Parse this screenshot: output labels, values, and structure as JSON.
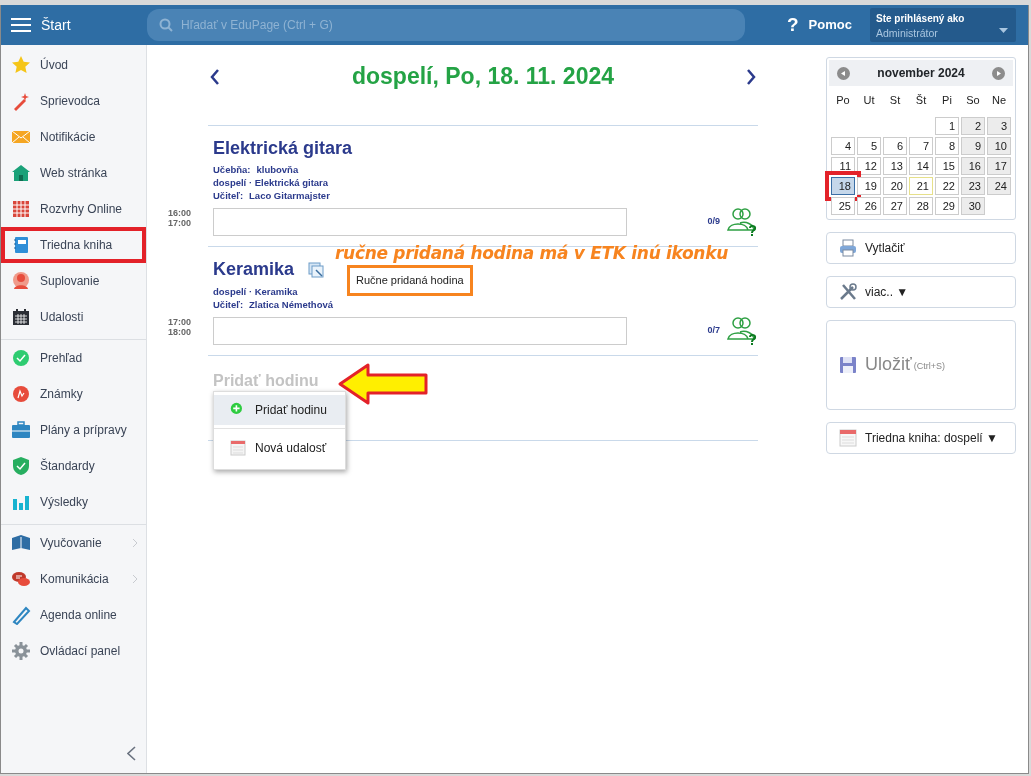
{
  "header": {
    "menu_label": "Štart",
    "search": {
      "placeholder": "Hľadať v EduPage (Ctrl + G)"
    },
    "help_icon": "?",
    "help": "Pomoc",
    "user": {
      "caption": "Ste prihlásený ako",
      "name": "Administrátor"
    }
  },
  "sidebar": {
    "groups": [
      {
        "items": [
          {
            "label": "Úvod",
            "highlighted": false,
            "submenu": false
          },
          {
            "label": "Sprievodca",
            "highlighted": false,
            "submenu": false
          },
          {
            "label": "Notifikácie",
            "highlighted": false,
            "submenu": false
          },
          {
            "label": "Web stránka",
            "highlighted": false,
            "submenu": false
          },
          {
            "label": "Rozvrhy Online",
            "highlighted": false,
            "submenu": false
          },
          {
            "label": "Triedna kniha",
            "highlighted": true,
            "submenu": false
          },
          {
            "label": "Suplovanie",
            "highlighted": false,
            "submenu": false
          },
          {
            "label": "Udalosti",
            "highlighted": false,
            "submenu": false
          }
        ]
      },
      {
        "items": [
          {
            "label": "Prehľad",
            "highlighted": false,
            "submenu": false
          },
          {
            "label": "Známky",
            "highlighted": false,
            "submenu": false
          },
          {
            "label": "Plány a prípravy",
            "highlighted": false,
            "submenu": false
          },
          {
            "label": "Štandardy",
            "highlighted": false,
            "submenu": false
          },
          {
            "label": "Výsledky",
            "highlighted": false,
            "submenu": false
          }
        ]
      },
      {
        "items": [
          {
            "label": "Vyučovanie",
            "highlighted": false,
            "submenu": true
          },
          {
            "label": "Komunikácia",
            "highlighted": false,
            "submenu": true
          },
          {
            "label": "Agenda online",
            "highlighted": false,
            "submenu": false
          },
          {
            "label": "Ovládací panel",
            "highlighted": false,
            "submenu": false
          }
        ]
      }
    ]
  },
  "day": {
    "title": "dospelí, Po, 18. 11. 2024"
  },
  "lessons": [
    {
      "title": "Elektrická gitara",
      "manual": false,
      "details": [
        {
          "label": "Učebňa:",
          "value": "klubovňa"
        },
        {
          "value": "dospelí · Elektrická gitara"
        },
        {
          "label": "Učiteľ:",
          "value": "Laco Gitarmajster"
        }
      ],
      "start": "16:00",
      "end": "17:00",
      "attendance": "0/9"
    },
    {
      "title": "Keramika",
      "manual": true,
      "tooltip": {
        "text": "Ručne pridaná hodina",
        "highlighted": true
      },
      "details": [
        {
          "value": "dospelí · Keramika"
        },
        {
          "label": "Učiteľ:",
          "value": "Zlatica Némethová"
        }
      ],
      "start": "17:00",
      "end": "18:00",
      "attendance": "0/7"
    }
  ],
  "add_lesson": {
    "label": "Pridať hodinu",
    "menu": [
      {
        "label": "Pridať hodinu",
        "selected": true
      },
      {
        "label": "Nová udalosť",
        "selected": false
      }
    ]
  },
  "annotation": {
    "note": "ručne pridaná hodina má v ETK inú ikonku",
    "arrow": true
  },
  "calendar": {
    "month": "november 2024",
    "weekdays": [
      "Po",
      "Ut",
      "St",
      "Št",
      "Pi",
      "So",
      "Ne"
    ],
    "weeks": [
      [
        {
          "d": "1",
          "weekend": false,
          "selected": false,
          "today": false,
          "highlighted": false
        },
        {
          "d": "2",
          "weekend": true,
          "selected": false,
          "today": false,
          "highlighted": false
        },
        {
          "d": "3",
          "weekend": true,
          "selected": false,
          "today": false,
          "highlighted": false
        }
      ],
      [
        {
          "d": "4",
          "weekend": false,
          "selected": false,
          "today": false,
          "highlighted": false
        },
        {
          "d": "5",
          "weekend": false,
          "selected": false,
          "today": false,
          "highlighted": false
        },
        {
          "d": "6",
          "weekend": false,
          "selected": false,
          "today": false,
          "highlighted": false
        },
        {
          "d": "7",
          "weekend": false,
          "selected": false,
          "today": false,
          "highlighted": false
        },
        {
          "d": "8",
          "weekend": false,
          "selected": false,
          "today": false,
          "highlighted": false
        },
        {
          "d": "9",
          "weekend": true,
          "selected": false,
          "today": false,
          "highlighted": false
        },
        {
          "d": "10",
          "weekend": true,
          "selected": false,
          "today": false,
          "highlighted": false
        }
      ],
      [
        {
          "d": "11",
          "weekend": false,
          "selected": false,
          "today": false,
          "highlighted": false
        },
        {
          "d": "12",
          "weekend": false,
          "selected": false,
          "today": false,
          "highlighted": false
        },
        {
          "d": "13",
          "weekend": false,
          "selected": false,
          "today": false,
          "highlighted": false
        },
        {
          "d": "14",
          "weekend": false,
          "selected": false,
          "today": false,
          "highlighted": false
        },
        {
          "d": "15",
          "weekend": false,
          "selected": false,
          "today": false,
          "highlighted": false
        },
        {
          "d": "16",
          "weekend": true,
          "selected": false,
          "today": false,
          "highlighted": false
        },
        {
          "d": "17",
          "weekend": true,
          "selected": false,
          "today": false,
          "highlighted": false
        }
      ],
      [
        {
          "d": "18",
          "weekend": false,
          "selected": true,
          "today": false,
          "highlighted": true
        },
        {
          "d": "19",
          "weekend": false,
          "selected": false,
          "today": false,
          "highlighted": false
        },
        {
          "d": "20",
          "weekend": false,
          "selected": false,
          "today": false,
          "highlighted": false
        },
        {
          "d": "21",
          "weekend": false,
          "selected": false,
          "today": true,
          "highlighted": false
        },
        {
          "d": "22",
          "weekend": false,
          "selected": false,
          "today": false,
          "highlighted": false
        },
        {
          "d": "23",
          "weekend": true,
          "selected": false,
          "today": false,
          "highlighted": false
        },
        {
          "d": "24",
          "weekend": true,
          "selected": false,
          "today": false,
          "highlighted": false
        }
      ],
      [
        {
          "d": "25",
          "weekend": false,
          "selected": false,
          "today": false,
          "highlighted": false
        },
        {
          "d": "26",
          "weekend": false,
          "selected": false,
          "today": false,
          "highlighted": false
        },
        {
          "d": "27",
          "weekend": false,
          "selected": false,
          "today": false,
          "highlighted": false
        },
        {
          "d": "28",
          "weekend": false,
          "selected": false,
          "today": false,
          "highlighted": false
        },
        {
          "d": "29",
          "weekend": false,
          "selected": false,
          "today": false,
          "highlighted": false
        },
        {
          "d": "30",
          "weekend": true,
          "selected": false,
          "today": false,
          "highlighted": false
        }
      ]
    ]
  },
  "actions": [
    {
      "kind": "print",
      "label": "Vytlačiť",
      "disabled": false
    },
    {
      "kind": "more",
      "label": "viac.. ▼",
      "disabled": false
    },
    {
      "kind": "save",
      "label": "Uložiť",
      "shortcut": "(Ctrl+S)",
      "disabled": true
    },
    {
      "kind": "book",
      "label": "Triedna kniha: dospelí ▼",
      "disabled": false
    }
  ]
}
